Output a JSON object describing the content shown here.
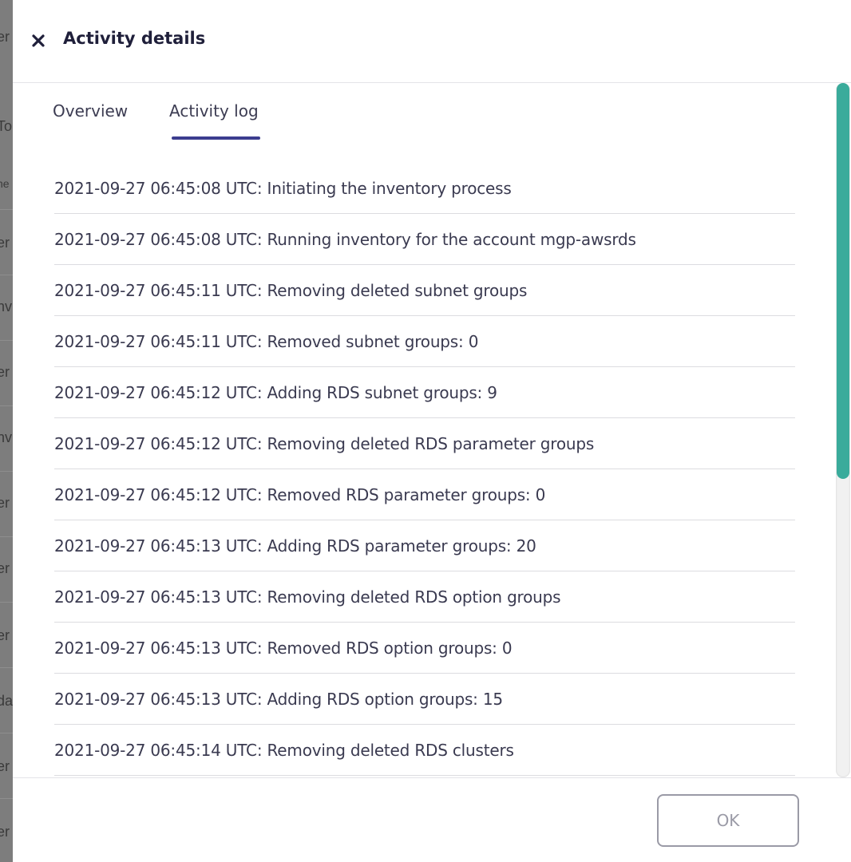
{
  "backdrop": {
    "fragments": [
      "er",
      "To",
      "ne",
      "er",
      "nv",
      "er",
      "nv",
      "er",
      "er",
      "er",
      "da",
      "er",
      "er"
    ]
  },
  "drawer": {
    "title": "Activity details",
    "close_icon": "close-icon"
  },
  "tabs": [
    {
      "label": "Overview",
      "active": false
    },
    {
      "label": "Activity log",
      "active": true
    }
  ],
  "activity_log": [
    "2021-09-27 06:45:08 UTC: Initiating the inventory process",
    "2021-09-27 06:45:08 UTC: Running inventory for the account mgp-awsrds",
    "2021-09-27 06:45:11 UTC: Removing deleted subnet groups",
    "2021-09-27 06:45:11 UTC: Removed subnet groups: 0",
    "2021-09-27 06:45:12 UTC: Adding RDS subnet groups: 9",
    "2021-09-27 06:45:12 UTC: Removing deleted RDS parameter groups",
    "2021-09-27 06:45:12 UTC: Removed RDS parameter groups: 0",
    "2021-09-27 06:45:13 UTC: Adding RDS parameter groups: 20",
    "2021-09-27 06:45:13 UTC: Removing deleted RDS option groups",
    "2021-09-27 06:45:13 UTC: Removed RDS option groups: 0",
    "2021-09-27 06:45:13 UTC: Adding RDS option groups: 15",
    "2021-09-27 06:45:14 UTC: Removing deleted RDS clusters"
  ],
  "footer": {
    "ok_label": "OK"
  },
  "colors": {
    "accent": "#3c3d8f",
    "scroll_thumb": "#3aab9b",
    "title_text": "#1f1f3a",
    "ok_border": "#9a9aa6"
  }
}
